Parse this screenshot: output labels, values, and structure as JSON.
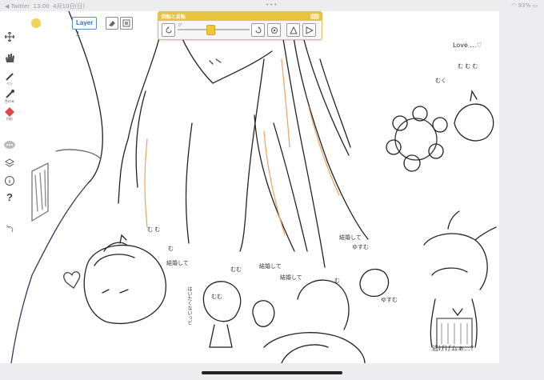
{
  "status_bar": {
    "app_back": "◀ Twitter",
    "time": "13:00",
    "date": "4月10日(日)",
    "dots": "•••",
    "battery": "93%"
  },
  "top_toolbar": {
    "layer_button": "Layer 1",
    "color": "#f7d259"
  },
  "left_toolbar": {
    "pen_label": "ペン",
    "fill_label": "色のみ",
    "shape_label": "円形"
  },
  "rotate_panel": {
    "title": "回転と反転",
    "slider_value": "0°",
    "slider_level": 0.45
  },
  "canvas_text": {
    "love": "Love …♡",
    "t1": "むく",
    "t2": "む む む",
    "t3": "む む",
    "t4": "む",
    "t5": "結婚して",
    "t6": "むむ",
    "t7": "ゆすむ",
    "t8": "結婚して",
    "t9": "むむ",
    "t10": "結婚して",
    "t11": "結婚して",
    "t12": "む",
    "t13": "ゆすむ",
    "t14": "逃げげムぁ…?",
    "t15": "はいたくないっピ"
  },
  "colors": {
    "accent": "#e8c33c",
    "hair_orange": "#f0a060",
    "layer_blue": "#3a6fc0"
  }
}
